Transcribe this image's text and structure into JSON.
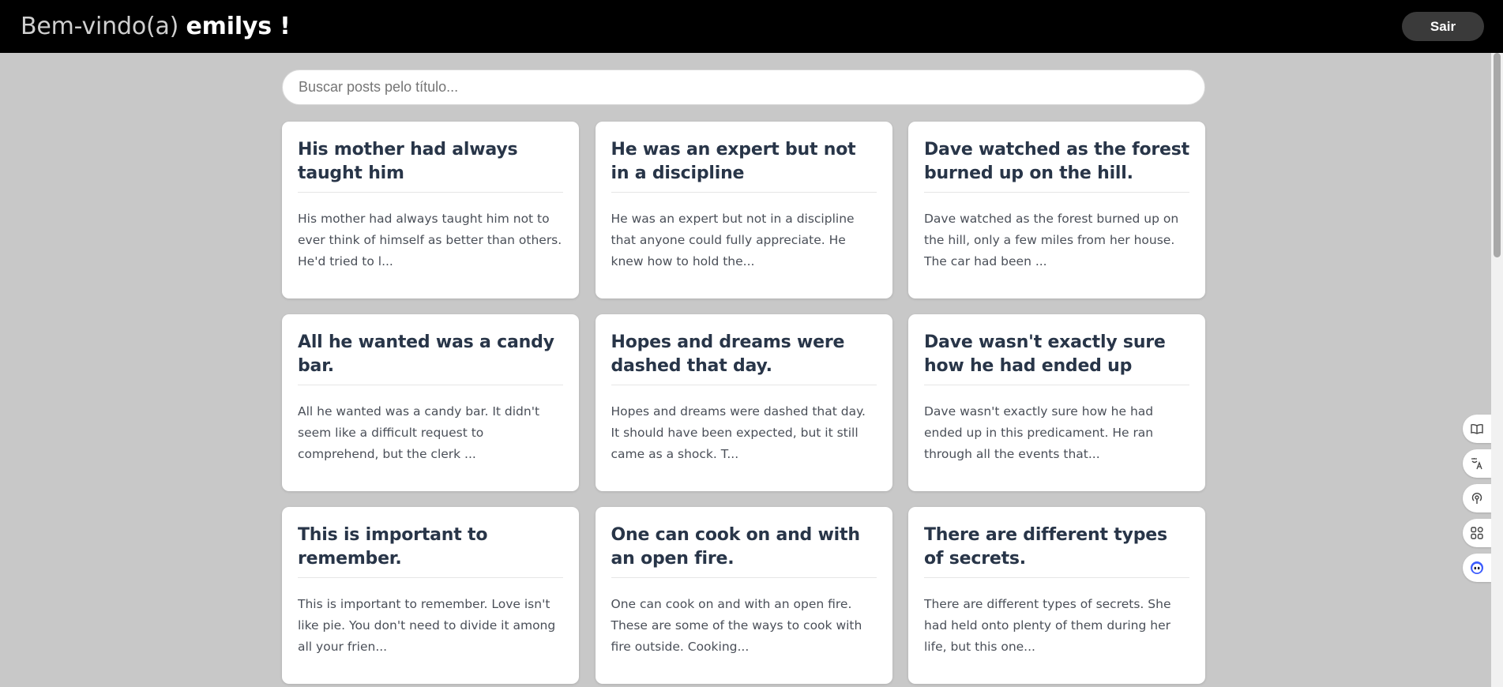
{
  "header": {
    "welcome_prefix": "Bem-vindo(a)",
    "username": "emilys",
    "welcome_suffix": " !",
    "logout_label": "Sair"
  },
  "search": {
    "placeholder": "Buscar posts pelo título..."
  },
  "posts": [
    {
      "title": "His mother had always taught him",
      "excerpt": "His mother had always taught him not to ever think of himself as better than others. He'd tried to l..."
    },
    {
      "title": "He was an expert but not in a discipline",
      "excerpt": "He was an expert but not in a discipline that anyone could fully appreciate. He knew how to hold the..."
    },
    {
      "title": "Dave watched as the forest burned up on the hill.",
      "excerpt": "Dave watched as the forest burned up on the hill, only a few miles from her house. The car had been ..."
    },
    {
      "title": "All he wanted was a candy bar.",
      "excerpt": "All he wanted was a candy bar. It didn't seem like a difficult request to comprehend, but the clerk ..."
    },
    {
      "title": "Hopes and dreams were dashed that day.",
      "excerpt": "Hopes and dreams were dashed that day. It should have been expected, but it still came as a shock. T..."
    },
    {
      "title": "Dave wasn't exactly sure how he had ended up",
      "excerpt": "Dave wasn't exactly sure how he had ended up in this predicament. He ran through all the events that..."
    },
    {
      "title": "This is important to remember.",
      "excerpt": "This is important to remember. Love isn't like pie. You don't need to divide it among all your frien..."
    },
    {
      "title": "One can cook on and with an open fire.",
      "excerpt": "One can cook on and with an open fire. These are some of the ways to cook with fire outside. Cooking..."
    },
    {
      "title": "There are different types of secrets.",
      "excerpt": "There are different types of secrets. She had held onto plenty of them during her life, but this one..."
    }
  ],
  "sidetools": [
    "book-icon",
    "translate-icon",
    "podcast-icon",
    "apps-icon",
    "assistant-icon"
  ],
  "colors": {
    "header_bg": "#000000",
    "page_bg": "#c8c8c8",
    "card_title": "#283548",
    "accent_assistant": "#3b5bfd"
  }
}
